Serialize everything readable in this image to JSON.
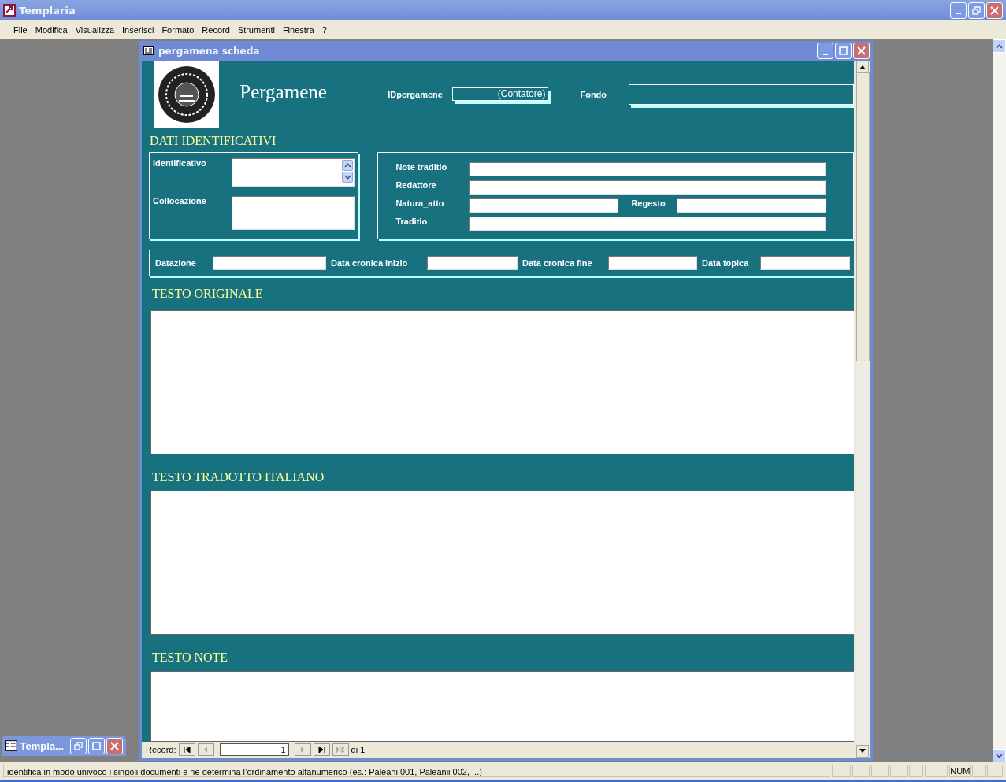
{
  "app": {
    "title": "Templaria"
  },
  "menu": [
    "File",
    "Modifica",
    "Visualizza",
    "Inserisci",
    "Formato",
    "Record",
    "Strumenti",
    "Finestra",
    "?"
  ],
  "form_window": {
    "title": "pergamena scheda"
  },
  "header": {
    "title": "Pergamene",
    "id_label": "IDpergamene",
    "id_value": "(Contatore)",
    "fondo_label": "Fondo"
  },
  "identification": {
    "heading": "DATI IDENTIFICATIVI",
    "left_fields": [
      {
        "label": "Identificativo",
        "kind": "spin"
      },
      {
        "label": "Collocazione",
        "kind": "text"
      }
    ],
    "right_rows": [
      [
        {
          "label": "Note traditio"
        }
      ],
      [
        {
          "label": "Redattore"
        }
      ],
      [
        {
          "label": "Natura_atto"
        },
        {
          "label": "Regesto"
        }
      ],
      [
        {
          "label": "Traditio"
        }
      ]
    ],
    "date_fields": [
      {
        "label": "Datazione"
      },
      {
        "label": "Data cronica inizio"
      },
      {
        "label": "Data cronica fine"
      },
      {
        "label": "Data topica"
      }
    ]
  },
  "text_sections": [
    {
      "heading": "TESTO ORIGINALE"
    },
    {
      "heading": "TESTO TRADOTTO ITALIANO"
    },
    {
      "heading": "TESTO NOTE"
    }
  ],
  "record_nav": {
    "label": "Record:",
    "value": "1",
    "total": "di 1"
  },
  "minimized_window": {
    "title": "Templa..."
  },
  "status_bar": {
    "message": "identifica in modo univoco i singoli documenti e ne determina l’ordinamento alfanumerico (es.: Paleani 001, Paleanii 002, ...)",
    "indicator": "NUM"
  }
}
